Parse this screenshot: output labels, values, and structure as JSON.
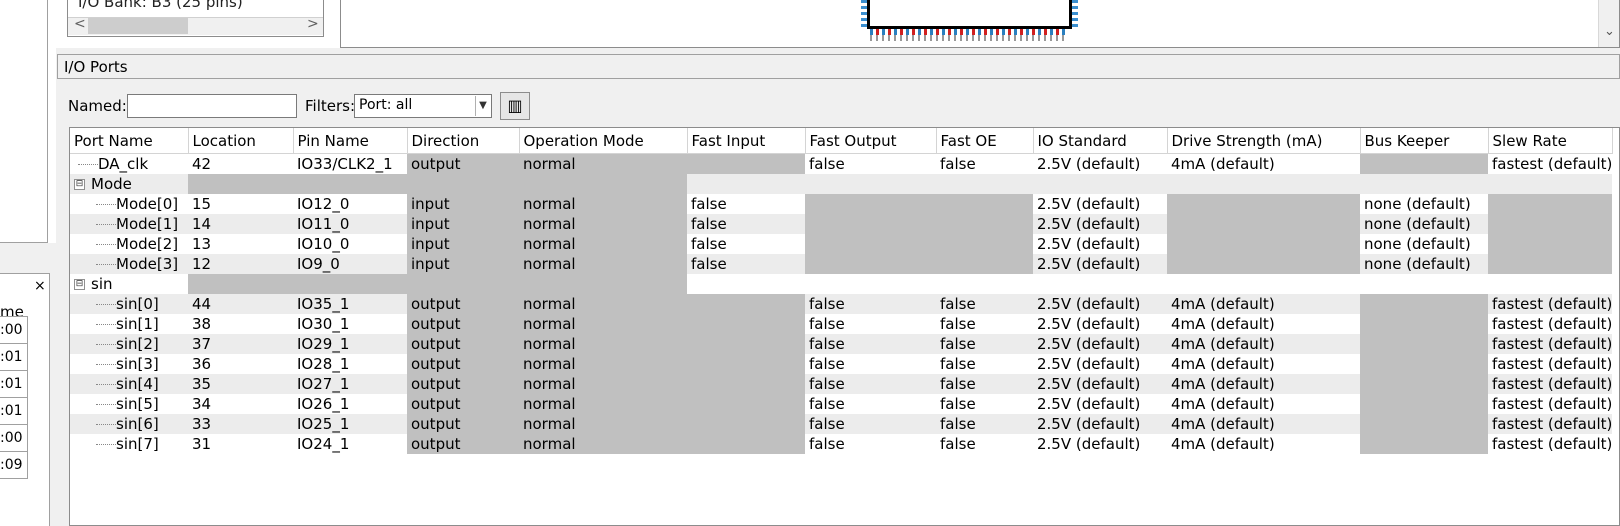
{
  "left_panel": {
    "close_glyph": "×",
    "time_header": "me",
    "time_values": [
      ":00",
      ":01",
      ":01",
      ":01",
      ":00",
      ":09"
    ]
  },
  "bank": {
    "label": "I/O Bank: B3 (25 pins)",
    "scroll_left": "<",
    "scroll_right": ">"
  },
  "package": {
    "scroll_down": "⌄"
  },
  "io_ports": {
    "title": "I/O Ports",
    "named_label": "Named:",
    "named_value": "",
    "filters_label": "Filters:",
    "filter_value": "Port: all",
    "filter_arrow": "▼",
    "tool_icon": "▥"
  },
  "table": {
    "columns": [
      "Port Name",
      "Location",
      "Pin Name",
      "Direction",
      "Operation Mode",
      "Fast Input",
      "Fast Output",
      "Fast OE",
      "IO Standard",
      "Drive Strength (mA)",
      "Bus Keeper",
      "Slew Rate"
    ],
    "rows": [
      {
        "name": "DA_clk",
        "location": "42",
        "pin": "IO33/CLK2_1",
        "direction": "output",
        "mode": "normal",
        "fast_input": "",
        "fast_output": "false",
        "fast_oe": "false",
        "io_std": "2.5V (default)",
        "drive": "4mA (default)",
        "bus_keeper": "",
        "slew": "fastest (default)"
      },
      {
        "name": "Mode",
        "expander": "⊟"
      },
      {
        "name": "Mode[0]",
        "location": "15",
        "pin": "IO12_0",
        "direction": "input",
        "mode": "normal",
        "fast_input": "false",
        "fast_output": "",
        "fast_oe": "",
        "io_std": "2.5V (default)",
        "drive": "",
        "bus_keeper": "none (default)",
        "slew": ""
      },
      {
        "name": "Mode[1]",
        "location": "14",
        "pin": "IO11_0",
        "direction": "input",
        "mode": "normal",
        "fast_input": "false",
        "fast_output": "",
        "fast_oe": "",
        "io_std": "2.5V (default)",
        "drive": "",
        "bus_keeper": "none (default)",
        "slew": ""
      },
      {
        "name": "Mode[2]",
        "location": "13",
        "pin": "IO10_0",
        "direction": "input",
        "mode": "normal",
        "fast_input": "false",
        "fast_output": "",
        "fast_oe": "",
        "io_std": "2.5V (default)",
        "drive": "",
        "bus_keeper": "none (default)",
        "slew": ""
      },
      {
        "name": "Mode[3]",
        "location": "12",
        "pin": "IO9_0",
        "direction": "input",
        "mode": "normal",
        "fast_input": "false",
        "fast_output": "",
        "fast_oe": "",
        "io_std": "2.5V (default)",
        "drive": "",
        "bus_keeper": "none (default)",
        "slew": ""
      },
      {
        "name": "sin",
        "expander": "⊟"
      },
      {
        "name": "sin[0]",
        "location": "44",
        "pin": "IO35_1",
        "direction": "output",
        "mode": "normal",
        "fast_input": "",
        "fast_output": "false",
        "fast_oe": "false",
        "io_std": "2.5V (default)",
        "drive": "4mA (default)",
        "bus_keeper": "",
        "slew": "fastest (default)"
      },
      {
        "name": "sin[1]",
        "location": "38",
        "pin": "IO30_1",
        "direction": "output",
        "mode": "normal",
        "fast_input": "",
        "fast_output": "false",
        "fast_oe": "false",
        "io_std": "2.5V (default)",
        "drive": "4mA (default)",
        "bus_keeper": "",
        "slew": "fastest (default)"
      },
      {
        "name": "sin[2]",
        "location": "37",
        "pin": "IO29_1",
        "direction": "output",
        "mode": "normal",
        "fast_input": "",
        "fast_output": "false",
        "fast_oe": "false",
        "io_std": "2.5V (default)",
        "drive": "4mA (default)",
        "bus_keeper": "",
        "slew": "fastest (default)"
      },
      {
        "name": "sin[3]",
        "location": "36",
        "pin": "IO28_1",
        "direction": "output",
        "mode": "normal",
        "fast_input": "",
        "fast_output": "false",
        "fast_oe": "false",
        "io_std": "2.5V (default)",
        "drive": "4mA (default)",
        "bus_keeper": "",
        "slew": "fastest (default)"
      },
      {
        "name": "sin[4]",
        "location": "35",
        "pin": "IO27_1",
        "direction": "output",
        "mode": "normal",
        "fast_input": "",
        "fast_output": "false",
        "fast_oe": "false",
        "io_std": "2.5V (default)",
        "drive": "4mA (default)",
        "bus_keeper": "",
        "slew": "fastest (default)"
      },
      {
        "name": "sin[5]",
        "location": "34",
        "pin": "IO26_1",
        "direction": "output",
        "mode": "normal",
        "fast_input": "",
        "fast_output": "false",
        "fast_oe": "false",
        "io_std": "2.5V (default)",
        "drive": "4mA (default)",
        "bus_keeper": "",
        "slew": "fastest (default)"
      },
      {
        "name": "sin[6]",
        "location": "33",
        "pin": "IO25_1",
        "direction": "output",
        "mode": "normal",
        "fast_input": "",
        "fast_output": "false",
        "fast_oe": "false",
        "io_std": "2.5V (default)",
        "drive": "4mA (default)",
        "bus_keeper": "",
        "slew": "fastest (default)"
      },
      {
        "name": "sin[7]",
        "location": "31",
        "pin": "IO24_1",
        "direction": "output",
        "mode": "normal",
        "fast_input": "",
        "fast_output": "false",
        "fast_oe": "false",
        "io_std": "2.5V (default)",
        "drive": "4mA (default)",
        "bus_keeper": "",
        "slew": "fastest (default)"
      }
    ]
  }
}
